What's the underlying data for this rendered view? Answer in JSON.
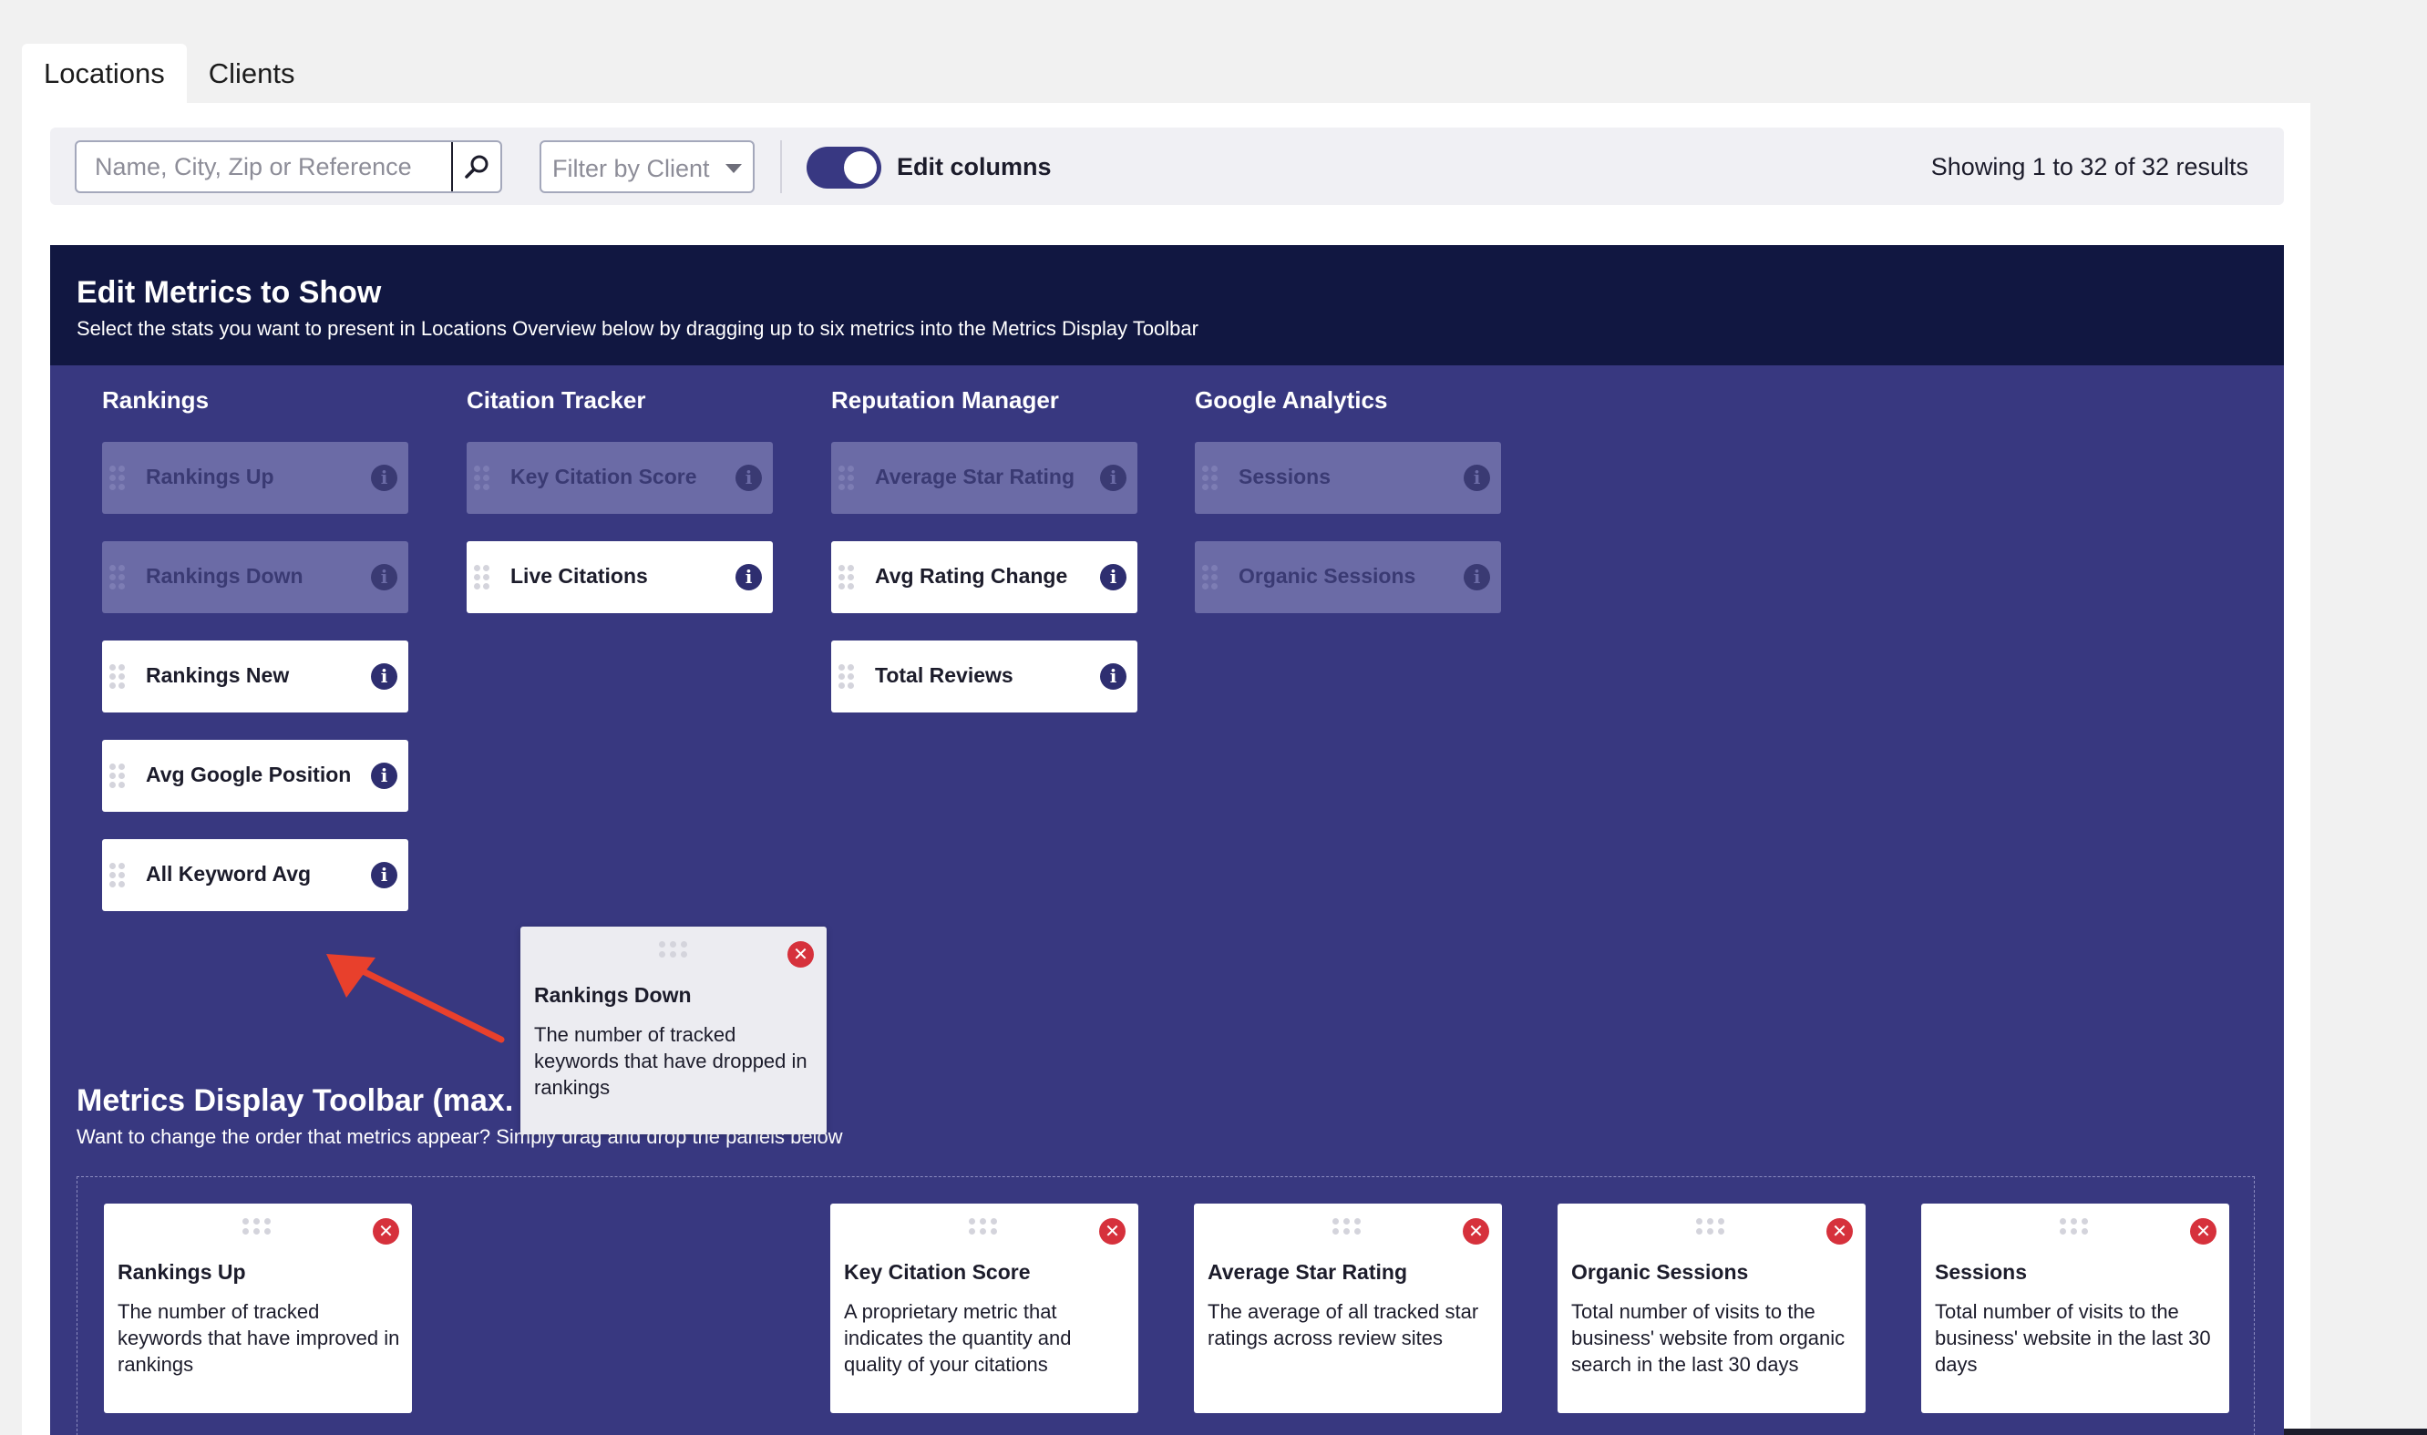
{
  "tabs": [
    {
      "label": "Locations",
      "active": true
    },
    {
      "label": "Clients",
      "active": false
    }
  ],
  "filters": {
    "search_placeholder": "Name, City, Zip or Reference",
    "search_value": "",
    "client_filter_label": "Filter by Client",
    "edit_columns_label": "Edit columns",
    "edit_columns_on": true,
    "results_text": "Showing 1 to 32 of 32 results"
  },
  "edit_panel": {
    "title": "Edit Metrics to Show",
    "subtitle": "Select the stats you want to present in Locations Overview below by dragging up to six metrics into the Metrics Display Toolbar",
    "columns": [
      {
        "title": "Rankings",
        "metrics": [
          {
            "label": "Rankings Up",
            "in_toolbar": true
          },
          {
            "label": "Rankings Down",
            "in_toolbar": true
          },
          {
            "label": "Rankings New",
            "in_toolbar": false
          },
          {
            "label": "Avg Google Position",
            "in_toolbar": false
          },
          {
            "label": "All Keyword Avg",
            "in_toolbar": false
          }
        ]
      },
      {
        "title": "Citation Tracker",
        "metrics": [
          {
            "label": "Key Citation Score",
            "in_toolbar": true
          },
          {
            "label": "Live Citations",
            "in_toolbar": false
          }
        ]
      },
      {
        "title": "Reputation Manager",
        "metrics": [
          {
            "label": "Average Star Rating",
            "in_toolbar": true
          },
          {
            "label": "Avg Rating Change",
            "in_toolbar": false
          },
          {
            "label": "Total Reviews",
            "in_toolbar": false
          }
        ]
      },
      {
        "title": "Google Analytics",
        "metrics": [
          {
            "label": "Sessions",
            "in_toolbar": true
          },
          {
            "label": "Organic Sessions",
            "in_toolbar": true
          }
        ]
      }
    ],
    "info_glyph": "i"
  },
  "dragging_card": {
    "title": "Rankings Down",
    "description": "The number of tracked keywords that have dropped in rankings"
  },
  "toolbar": {
    "title": "Metrics Display Toolbar (max. 6)",
    "subtitle": "Want to change the order that metrics appear? Simply drag and drop the panels below",
    "cards": [
      {
        "title": "Rankings Up",
        "description": "The number of tracked keywords that have improved in rankings"
      },
      {
        "title": "Key Citation Score",
        "description": "A proprietary metric that indicates the quantity and quality of your citations"
      },
      {
        "title": "Average Star Rating",
        "description": "The average of all tracked star ratings across review sites"
      },
      {
        "title": "Organic Sessions",
        "description": "Total number of visits to the business' website from organic search in the last 30 days"
      },
      {
        "title": "Sessions",
        "description": "Total number of visits to the business' website in the last 30 days"
      }
    ],
    "close_glyph": "✕"
  },
  "colors": {
    "panel": "#383880",
    "header": "#111741",
    "accent": "#383882",
    "close": "#d6313c",
    "arrow": "#e8402c"
  },
  "icons": [
    "search-icon",
    "chevron-down-icon",
    "info-icon",
    "drag-handle-icon",
    "close-icon",
    "arrow-annotation"
  ]
}
